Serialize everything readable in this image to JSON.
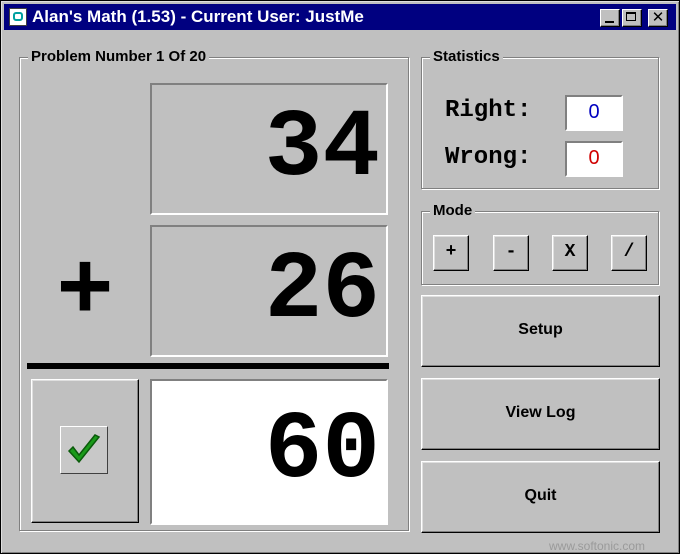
{
  "window": {
    "title": "Alan's Math (1.53) - Current User: JustMe",
    "close_glyph": "✕"
  },
  "problem": {
    "group_label": "Problem Number 1 Of 20",
    "operand1": "34",
    "operator": "+",
    "operand2": "26",
    "answer": "60",
    "check_icon": "checkmark-icon"
  },
  "statistics": {
    "group_label": "Statistics",
    "right_label": "Right:",
    "right_value": "0",
    "wrong_label": "Wrong:",
    "wrong_value": "0",
    "right_color": "#0000c0",
    "wrong_color": "#d00000"
  },
  "mode": {
    "group_label": "Mode",
    "buttons": [
      {
        "label": "+"
      },
      {
        "label": "-"
      },
      {
        "label": "X"
      },
      {
        "label": "/"
      }
    ]
  },
  "actions": {
    "setup": "Setup",
    "view_log": "View Log",
    "quit": "Quit"
  },
  "watermark": "www.softonic.com",
  "colors": {
    "titlebar": "#000080",
    "face": "#c0c0c0",
    "check_green": "#1a9a1a"
  }
}
